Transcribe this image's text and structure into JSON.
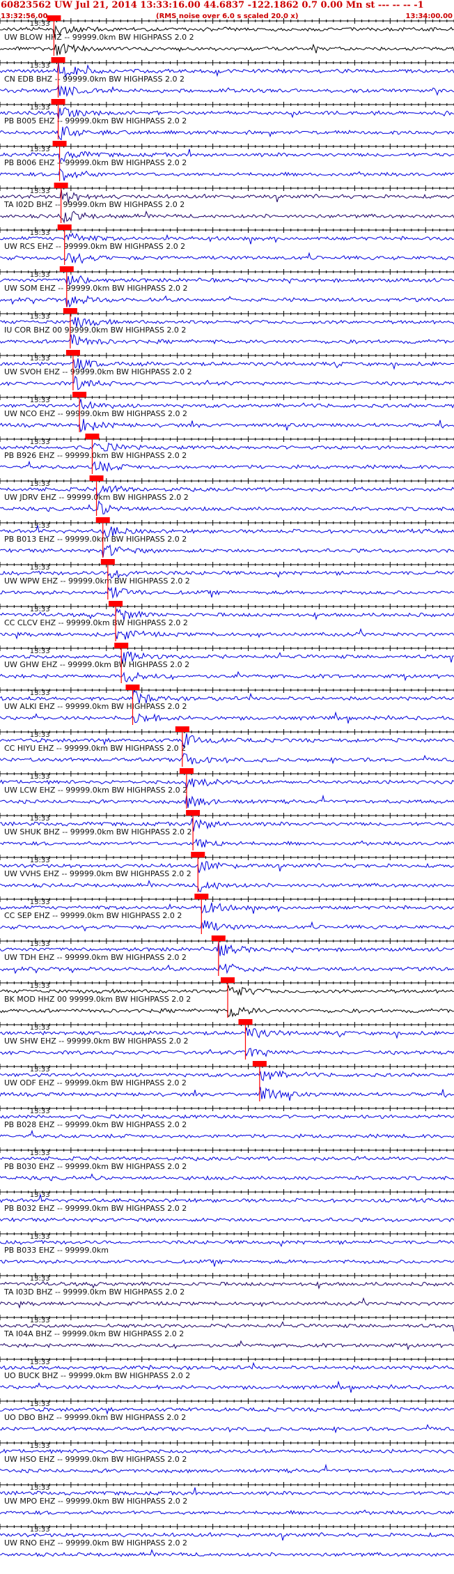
{
  "header": {
    "title": "60823562 UW Jul 21, 2014 13:33:16.00   44.6837 -122.1862  0.7 0.00 Mn st --- -- --  -1",
    "start_time": "13:32:56.00",
    "note": "(RMS noise over 6.0 s scaled 20.0 x)",
    "end_time": "13:34:00.00"
  },
  "minute_label": "13:33",
  "colors": {
    "header": "#cc0000",
    "trace_blue": "#0000dd",
    "trace_dark": "#1a0066",
    "trace_black": "#000000",
    "pick": "#ff0000"
  },
  "chart_data": {
    "type": "line",
    "title": "60823562 UW Jul 21, 2014 13:33:16.00   44.6837 -122.1862  0.7 0.00 Mn st --- -- --  -1",
    "x_range": [
      "13:32:56.00",
      "13:34:00.00"
    ],
    "tick_interval_s": 1,
    "grid": false,
    "series": [
      {
        "name": "UW BLOW HHZ -- 99999.0km BW  HIGHPASS  2.0  2",
        "pick_s": 7.6
      },
      {
        "name": "CN EDB BHZ -- 99999.0km BW  HIGHPASS  2.0  2",
        "pick_s": 8.2
      },
      {
        "name": "PB B005 EHZ -- 99999.0km BW  HIGHPASS  2.0  2",
        "pick_s": 8.2
      },
      {
        "name": "PB B006 EHZ -- 99999.0km BW  HIGHPASS  2.0  2",
        "pick_s": 8.4
      },
      {
        "name": "TA I02D BHZ -- 99999.0km BW  HIGHPASS  2.0  2",
        "pick_s": 8.6
      },
      {
        "name": "UW RCS EHZ -- 99999.0km BW  HIGHPASS  2.0  2",
        "pick_s": 9.1
      },
      {
        "name": "UW SOM EHZ -- 99999.0km BW  HIGHPASS  2.0  2",
        "pick_s": 9.4
      },
      {
        "name": "IU COR BHZ 00 99999.0km BW  HIGHPASS  2.0  2",
        "pick_s": 9.9
      },
      {
        "name": "UW SVOH EHZ -- 99999.0km BW  HIGHPASS  2.0  2",
        "pick_s": 10.3
      },
      {
        "name": "UW NCO EHZ -- 99999.0km BW  HIGHPASS  2.0  2",
        "pick_s": 11.2
      },
      {
        "name": "PB B926 EHZ -- 99999.0km BW  HIGHPASS  2.0  2",
        "pick_s": 13.0
      },
      {
        "name": "UW JDRV EHZ -- 99999.0km BW  HIGHPASS  2.0  2",
        "pick_s": 13.6
      },
      {
        "name": "PB B013 EHZ -- 99999.0km BW  HIGHPASS  2.0  2",
        "pick_s": 14.5
      },
      {
        "name": "UW WPW EHZ -- 99999.0km BW  HIGHPASS  2.0  2",
        "pick_s": 15.2
      },
      {
        "name": "CC CLCV EHZ -- 99999.0km BW  HIGHPASS  2.0  2",
        "pick_s": 16.3
      },
      {
        "name": "UW GHW EHZ -- 99999.0km BW  HIGHPASS  2.0  2",
        "pick_s": 17.1
      },
      {
        "name": "UW ALKI EHZ -- 99999.0km BW  HIGHPASS  2.0  2",
        "pick_s": 18.7
      },
      {
        "name": "CC HIYU EHZ -- 99999.0km BW  HIGHPASS  2.0  2",
        "pick_s": 25.7
      },
      {
        "name": "UW LCW EHZ -- 99999.0km BW  HIGHPASS  2.0  2",
        "pick_s": 26.3
      },
      {
        "name": "UW SHUK BHZ -- 99999.0km BW  HIGHPASS  2.0  2",
        "pick_s": 27.2
      },
      {
        "name": "UW VVHS EHZ -- 99999.0km BW  HIGHPASS  2.0  2",
        "pick_s": 27.9
      },
      {
        "name": "CC SEP EHZ -- 99999.0km BW  HIGHPASS  2.0  2",
        "pick_s": 28.4
      },
      {
        "name": "UW TDH EHZ -- 99999.0km BW  HIGHPASS  2.0  2",
        "pick_s": 30.8
      },
      {
        "name": "BK MOD HHZ 00 99999.0km BW  HIGHPASS  2.0  2",
        "pick_s": 32.1
      },
      {
        "name": "UW SHW EHZ -- 99999.0km BW  HIGHPASS  2.0  2",
        "pick_s": 34.6
      },
      {
        "name": "UW ODF EHZ -- 99999.0km BW  HIGHPASS  2.0  2",
        "pick_s": 36.6
      },
      {
        "name": "PB B028 EHZ -- 99999.0km BW  HIGHPASS  2.0  2",
        "pick_s": null
      },
      {
        "name": "PB B030 EHZ -- 99999.0km BW  HIGHPASS  2.0  2",
        "pick_s": null
      },
      {
        "name": "PB B032 EHZ -- 99999.0km BW  HIGHPASS  2.0  2",
        "pick_s": null
      },
      {
        "name": "PB B033 EHZ -- 99999.0km",
        "pick_s": null
      },
      {
        "name": "TA I03D BHZ -- 99999.0km BW  HIGHPASS  2.0  2",
        "pick_s": null
      },
      {
        "name": "TA I04A BHZ -- 99999.0km BW  HIGHPASS  2.0  2",
        "pick_s": null
      },
      {
        "name": "UO BUCK BHZ -- 99999.0km BW  HIGHPASS  2.0  2",
        "pick_s": null
      },
      {
        "name": "UO DBO BHZ -- 99999.0km BW  HIGHPASS  2.0  2",
        "pick_s": null
      },
      {
        "name": "UW HSO EHZ -- 99999.0km BW  HIGHPASS  2.0  2",
        "pick_s": null
      },
      {
        "name": "UW MPO EHZ -- 99999.0km BW  HIGHPASS  2.0  2",
        "pick_s": null
      },
      {
        "name": "UW RNO EHZ -- 99999.0km BW  HIGHPASS  2.0  2",
        "pick_s": null
      }
    ]
  }
}
